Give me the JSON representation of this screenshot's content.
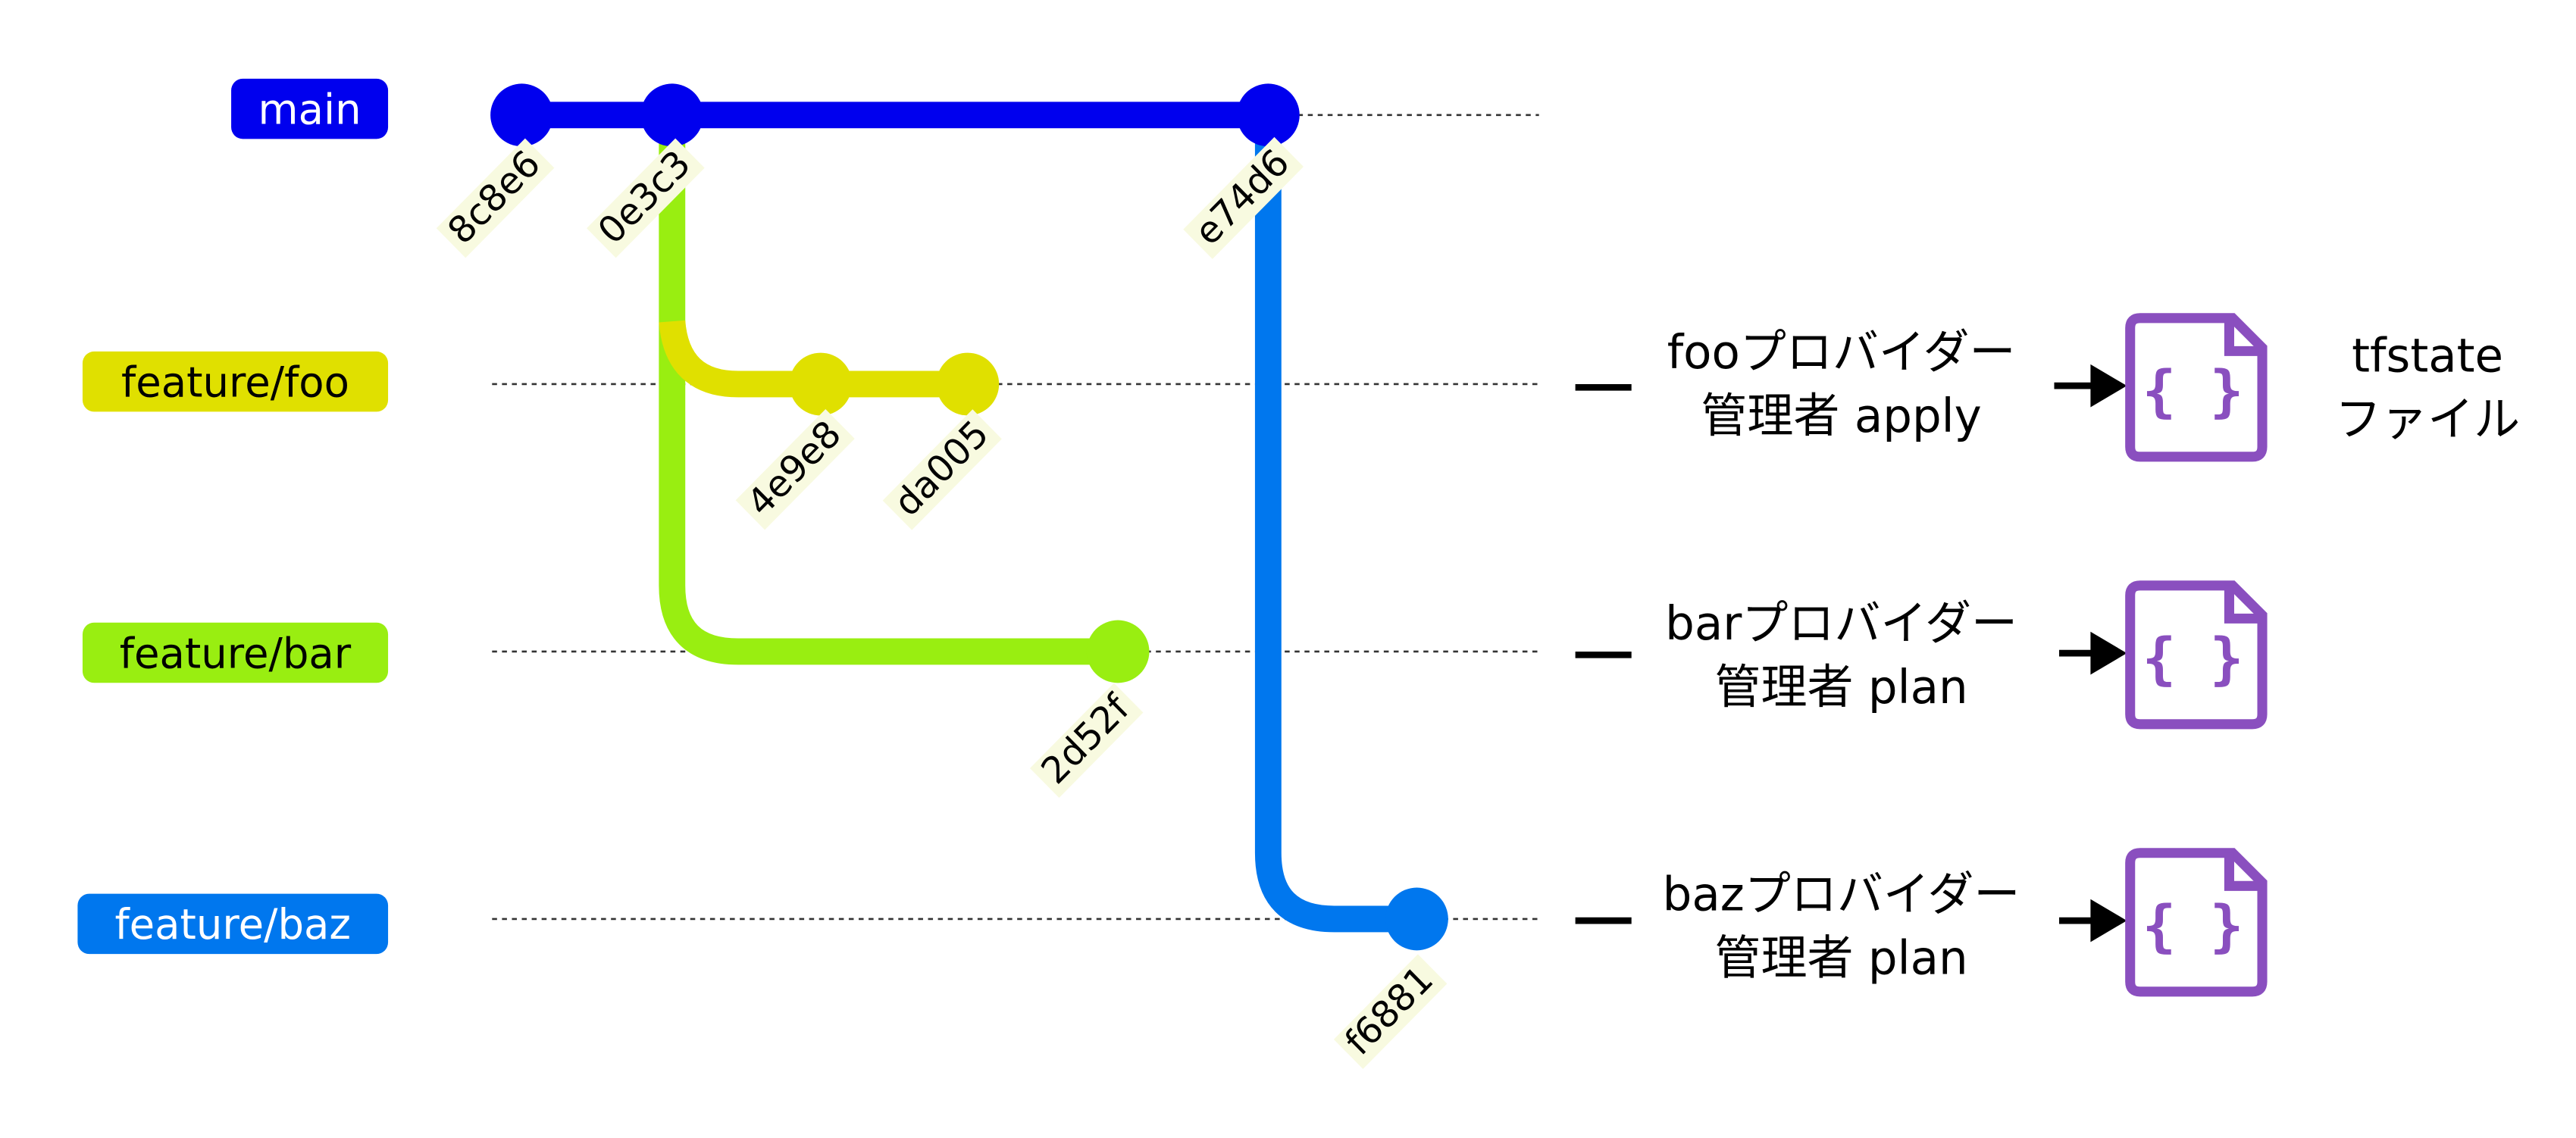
{
  "branches": [
    {
      "name": "main",
      "color": "#0000ee",
      "text_color": "#ffffff"
    },
    {
      "name": "feature/foo",
      "color": "#e0e000",
      "text_color": "#000000"
    },
    {
      "name": "feature/bar",
      "color": "#99ee11",
      "text_color": "#000000"
    },
    {
      "name": "feature/baz",
      "color": "#0077ee",
      "text_color": "#ffffff"
    }
  ],
  "commits": {
    "c1": "8c8e6",
    "c2": "0e3c3",
    "c3": "e74d6",
    "c4": "4e9e8",
    "c5": "da005",
    "c6": "2d52f",
    "c7": "f6881"
  },
  "rows": [
    {
      "line1": "fooプロバイダー",
      "line2": "管理者 apply"
    },
    {
      "line1": "barプロバイダー",
      "line2": "管理者 plan"
    },
    {
      "line1": "bazプロバイダー",
      "line2": "管理者 plan"
    }
  ],
  "file_caption": {
    "line1": "tfstate",
    "line2": "ファイル"
  },
  "icons": {
    "file": "json-file-icon",
    "arrow": "right-arrow-icon"
  },
  "colors": {
    "file_icon": "#8a4fbf"
  }
}
